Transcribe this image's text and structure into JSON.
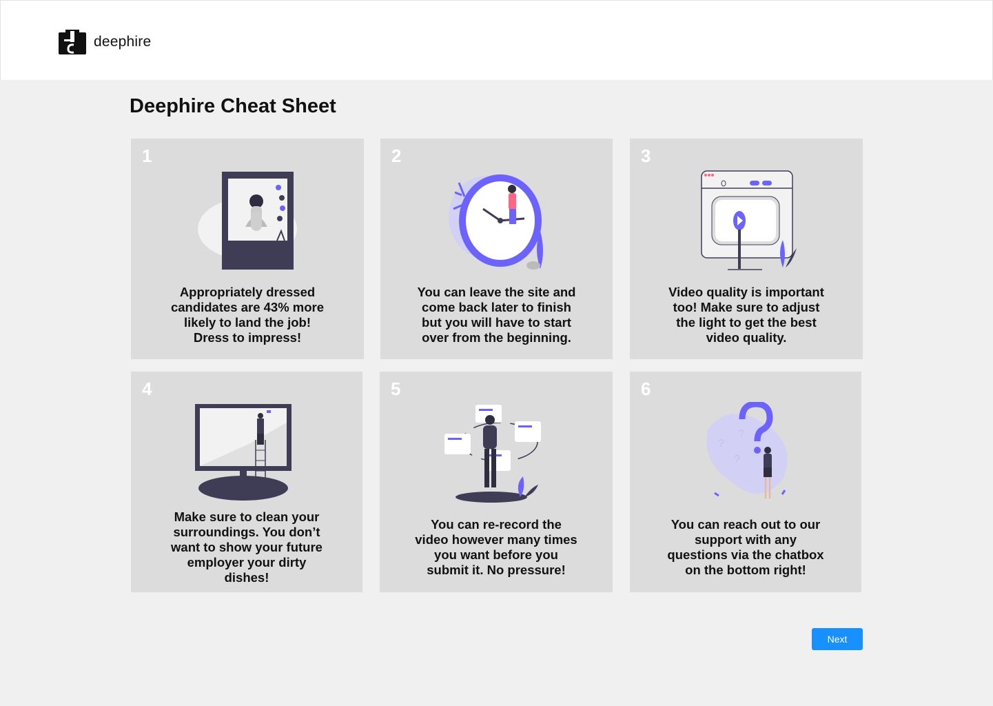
{
  "header": {
    "brand": "deephire"
  },
  "page": {
    "title": "Deephire Cheat Sheet"
  },
  "cards": [
    {
      "number": "1",
      "text": "Appropriately dressed\ncandidates are 43% more\nlikely to land the job!\nDress to impress!",
      "icon": "portrait-window-illustration"
    },
    {
      "number": "2",
      "text": "You can leave the site and\ncome back later to finish\nbut you will have to start\nover from the beginning.",
      "icon": "clock-illustration"
    },
    {
      "number": "3",
      "text": "Video quality is important\ntoo! Make sure to adjust\nthe light to get the best\nvideo quality.",
      "icon": "video-browser-illustration"
    },
    {
      "number": "4",
      "text": "Make sure to clean your\nsurroundings. You don’t\nwant to show your future\nemployer your dirty\ndishes!",
      "icon": "monitor-cleaning-illustration"
    },
    {
      "number": "5",
      "text": "You can re-record the\nvideo however many times\nyou want before you\nsubmit it. No pressure!",
      "icon": "orbiting-notes-illustration"
    },
    {
      "number": "6",
      "text": "You can reach out to our\nsupport with any\nquestions via the chatbox\non the bottom right!",
      "icon": "question-mark-illustration"
    }
  ],
  "footer": {
    "next_label": "Next"
  },
  "colors": {
    "accent": "#6c63ff",
    "button": "#1890ff",
    "card_bg": "#dcdcdc",
    "dark": "#3f3d56"
  }
}
